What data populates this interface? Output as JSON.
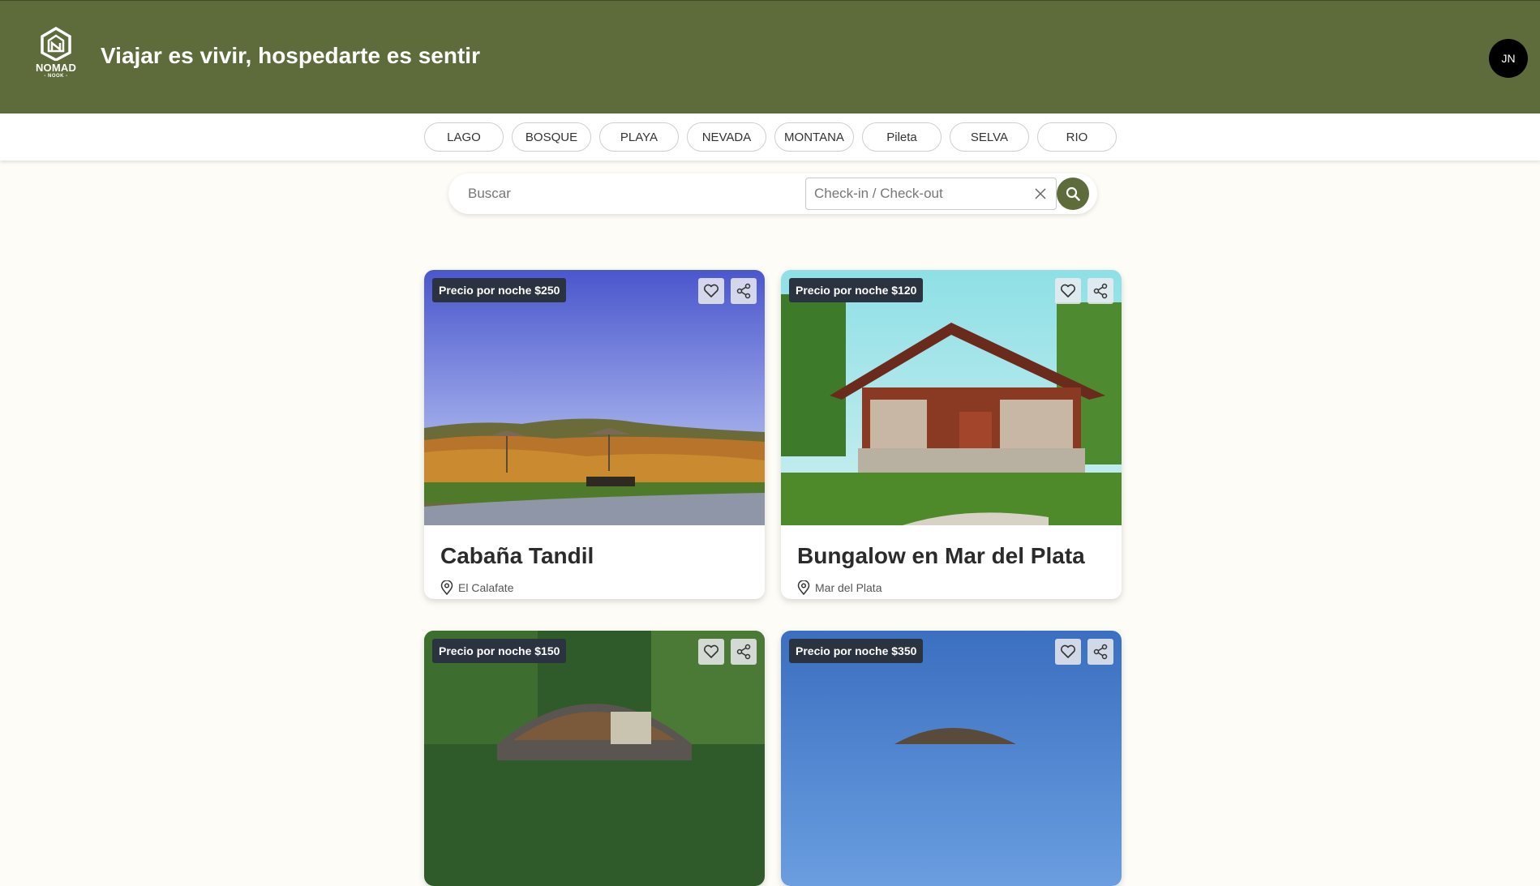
{
  "header": {
    "logo_brand": "NOMAD",
    "logo_sub": "- NOOK -",
    "tagline": "Viajar es vivir, hospedarte es sentir",
    "avatar_initials": "JN"
  },
  "categories": [
    "LAGO",
    "BOSQUE",
    "PLAYA",
    "NEVADA",
    "MONTANA",
    "Pileta",
    "SELVA",
    "RIO"
  ],
  "search": {
    "placeholder": "Buscar",
    "date_placeholder": "Check-in / Check-out"
  },
  "listings": [
    {
      "price_label": "Precio por noche $250",
      "title": "Cabaña Tandil",
      "location": "El Calafate"
    },
    {
      "price_label": "Precio por noche $120",
      "title": "Bungalow en Mar del Plata",
      "location": "Mar del Plata"
    },
    {
      "price_label": "Precio por noche $150",
      "title": "",
      "location": ""
    },
    {
      "price_label": "Precio por noche $350",
      "title": "",
      "location": ""
    }
  ],
  "colors": {
    "header_bg": "#5e6b3a",
    "page_bg": "#fdfcf6",
    "accent": "#5e6b3a",
    "badge_bg": "#2c3340"
  },
  "icons": [
    "nomad-logo-icon",
    "search-icon",
    "close-icon",
    "heart-icon",
    "share-icon",
    "location-pin-icon"
  ]
}
